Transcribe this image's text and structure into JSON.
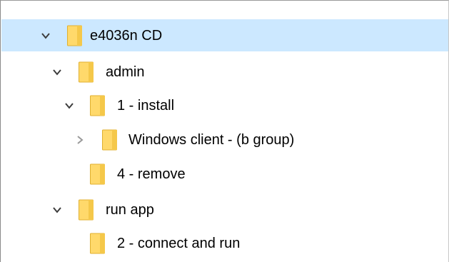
{
  "colors": {
    "selection": "#cce8ff",
    "folder_fill": "#ffd96b",
    "folder_edge": "#e0b030",
    "chevron": "#3c3c3c",
    "chevron_collapsed": "#9a9a9a"
  },
  "tree": {
    "items": [
      {
        "label": "e4036n CD",
        "state": "expanded",
        "selected": true,
        "icon": "folder-icon"
      },
      {
        "label": "admin",
        "state": "expanded",
        "selected": false,
        "icon": "folder-icon"
      },
      {
        "label": "1 - install",
        "state": "expanded",
        "selected": false,
        "icon": "folder-icon"
      },
      {
        "label": "Windows client - (b group)",
        "state": "collapsed",
        "selected": false,
        "icon": "folder-icon"
      },
      {
        "label": "4 - remove",
        "state": "leaf",
        "selected": false,
        "icon": "folder-icon"
      },
      {
        "label": "run app",
        "state": "expanded",
        "selected": false,
        "icon": "folder-icon"
      },
      {
        "label": "2 - connect and run",
        "state": "leaf",
        "selected": false,
        "icon": "folder-icon"
      }
    ]
  }
}
